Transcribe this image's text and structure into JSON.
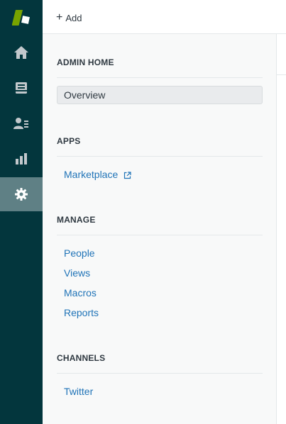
{
  "header": {
    "add_label": "Add"
  },
  "rail": {
    "items": [
      {
        "icon": "home-icon"
      },
      {
        "icon": "views-icon"
      },
      {
        "icon": "customers-icon"
      },
      {
        "icon": "reporting-icon"
      },
      {
        "icon": "admin-gear-icon",
        "active": true
      }
    ],
    "colors": {
      "background": "#03363d",
      "active": "#5f8085",
      "logo_green": "#78a300"
    }
  },
  "admin_panel": {
    "sections": [
      {
        "title": "ADMIN HOME",
        "items": [
          "Overview"
        ]
      },
      {
        "title": "APPS",
        "items": [
          "Marketplace"
        ]
      },
      {
        "title": "MANAGE",
        "items": [
          "People",
          "Views",
          "Macros",
          "Reports"
        ]
      },
      {
        "title": "CHANNELS",
        "items": [
          "Twitter"
        ]
      }
    ],
    "link_color": "#1f73b7"
  }
}
